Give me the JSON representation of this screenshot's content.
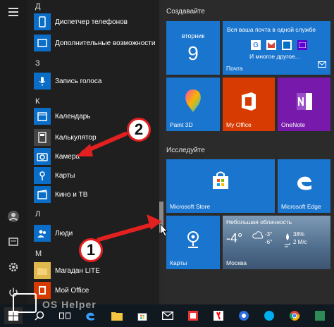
{
  "letters": {
    "d": "Д",
    "z": "З",
    "k": "К",
    "l": "Л",
    "m": "М"
  },
  "apps": {
    "device_manager": "Диспетчер телефонов",
    "accessibility": "Дополнительные возможности",
    "voice_recorder": "Запись голоса",
    "calendar": "Календарь",
    "calculator": "Калькулятор",
    "camera": "Камера",
    "maps": "Карты",
    "movies": "Кино и ТВ",
    "people": "Люди",
    "magadan": "Магадан LITE",
    "my_office": "Мой Office"
  },
  "groups": {
    "create": "Создавайте",
    "explore": "Исследуйте"
  },
  "tiles": {
    "calendar_day": "вторник",
    "calendar_date": "9",
    "mail_title": "Вся ваша почта в одной службе",
    "mail_more": "И многое другое...",
    "mail_label": "Почта",
    "paint3d": "Paint 3D",
    "myoffice": "My Office",
    "onenote": "OneNote",
    "store": "Microsoft Store",
    "edge": "Microsoft Edge",
    "maps": "Карты",
    "weather_title": "Небольшая облачность",
    "weather_temp": "-4°",
    "weather_c1": "-3°",
    "weather_c2": "-6°",
    "weather_hum": "38%",
    "weather_wind": "2 М/с",
    "weather_city": "Москва"
  },
  "callouts": {
    "one": "1",
    "two": "2"
  },
  "watermark": "OS Helper",
  "colors": {
    "tile_blue": "#1a75cf",
    "office_red": "#d83b01",
    "onenote_purple": "#7719aa",
    "callout_red": "#e32020"
  }
}
